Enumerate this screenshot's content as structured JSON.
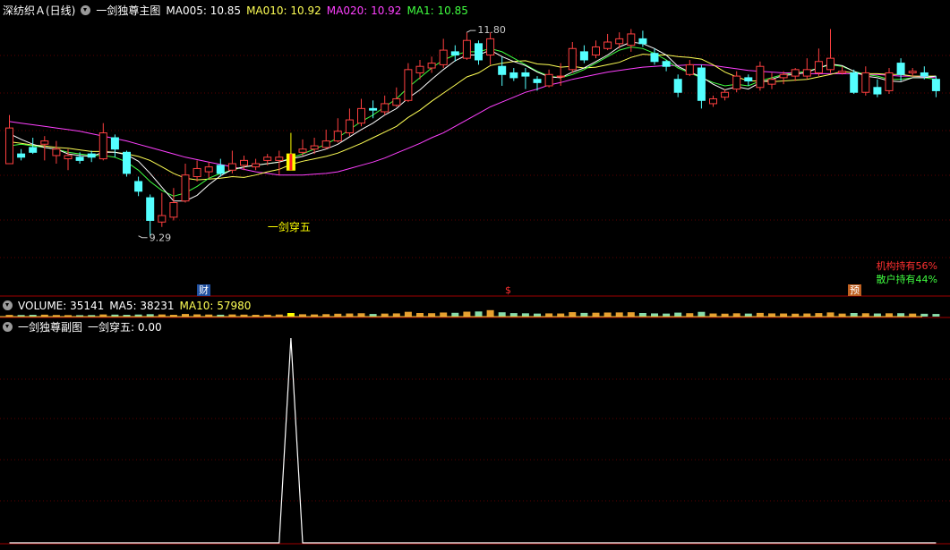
{
  "main_header": {
    "stock": "深纺织Ａ(日线)",
    "indicator": "一剑独尊主图",
    "ma005": "MA005: 10.85",
    "ma010": "MA010: 10.92",
    "ma020": "MA020: 10.92",
    "ma1": "MA1: 10.85"
  },
  "volume_header": {
    "volume": "VOLUME: 35141",
    "ma5": "MA5: 38231",
    "ma10": "MA10: 57980"
  },
  "sub_header": {
    "indicator": "一剑独尊副图",
    "value": "一剑穿五: 0.00"
  },
  "holdings": {
    "institution": "机构持有56%",
    "retail": "散户持有44%"
  },
  "badges": {
    "finance": "财",
    "dollar": "$",
    "forecast": "预"
  },
  "colors": {
    "up": "#ff4040",
    "down": "#54ffff",
    "ma5": "#ffffff",
    "ma10": "#ffff55",
    "ma20": "#ff40ff",
    "ma1": "#40ff40",
    "signal": "#ffff00",
    "background": "#000000",
    "grid": "#7a0000"
  },
  "chart_data": [
    {
      "type": "candlestick",
      "title": "一剑独尊主图",
      "annotations": [
        {
          "text": "11.80",
          "bar": 39,
          "value": 11.8,
          "kind": "high"
        },
        {
          "text": "9.29",
          "bar": 11,
          "value": 9.29,
          "kind": "low"
        },
        {
          "text": "一剑穿五",
          "bar": 24,
          "kind": "signal"
        }
      ],
      "signal_bar": 24,
      "ylim": [
        9.0,
        12.0
      ],
      "ohlc": [
        [
          10.18,
          10.62,
          10.78,
          10.32
        ],
        [
          10.3,
          10.26,
          10.36,
          10.22
        ],
        [
          10.38,
          10.32,
          10.5,
          10.3
        ],
        [
          10.42,
          10.46,
          10.52,
          10.22
        ],
        [
          10.28,
          10.36,
          10.46,
          10.18
        ],
        [
          10.24,
          10.28,
          10.36,
          10.1
        ],
        [
          10.26,
          10.22,
          10.32,
          10.18
        ],
        [
          10.3,
          10.26,
          10.34,
          10.2
        ],
        [
          10.24,
          10.56,
          10.68,
          10.22
        ],
        [
          10.5,
          10.36,
          10.54,
          10.26
        ],
        [
          10.32,
          10.06,
          10.34,
          10.02
        ],
        [
          9.96,
          9.84,
          10.02,
          9.78
        ],
        [
          9.76,
          9.48,
          9.8,
          9.29
        ],
        [
          9.46,
          9.54,
          9.82,
          9.4
        ],
        [
          9.52,
          9.7,
          9.88,
          9.48
        ],
        [
          9.72,
          10.04,
          10.18,
          9.7
        ],
        [
          10.02,
          10.12,
          10.22,
          9.96
        ],
        [
          10.08,
          10.14,
          10.2,
          10.0
        ],
        [
          10.16,
          10.06,
          10.24,
          10.02
        ],
        [
          10.1,
          10.18,
          10.34,
          10.06
        ],
        [
          10.16,
          10.22,
          10.28,
          10.1
        ],
        [
          10.14,
          10.18,
          10.24,
          10.1
        ],
        [
          10.22,
          10.26,
          10.3,
          10.16
        ],
        [
          10.22,
          10.26,
          10.34,
          10.04
        ],
        [
          10.1,
          10.3,
          10.56,
          10.1
        ],
        [
          10.32,
          10.36,
          10.48,
          10.28
        ],
        [
          10.36,
          10.4,
          10.5,
          10.3
        ],
        [
          10.38,
          10.46,
          10.6,
          10.36
        ],
        [
          10.46,
          10.58,
          10.74,
          10.44
        ],
        [
          10.56,
          10.72,
          10.86,
          10.52
        ],
        [
          10.68,
          10.86,
          10.98,
          10.64
        ],
        [
          10.86,
          10.84,
          10.96,
          10.74
        ],
        [
          10.82,
          10.92,
          11.02,
          10.78
        ],
        [
          10.9,
          10.98,
          11.12,
          10.88
        ],
        [
          10.96,
          11.34,
          11.42,
          10.94
        ],
        [
          11.3,
          11.38,
          11.46,
          11.22
        ],
        [
          11.36,
          11.42,
          11.5,
          11.3
        ],
        [
          11.4,
          11.58,
          11.72,
          11.36
        ],
        [
          11.56,
          11.52,
          11.64,
          11.44
        ],
        [
          11.48,
          11.7,
          11.8,
          11.46
        ],
        [
          11.66,
          11.46,
          11.7,
          11.4
        ],
        [
          11.52,
          11.72,
          11.8,
          11.4
        ],
        [
          11.38,
          11.28,
          11.5,
          11.14
        ],
        [
          11.3,
          11.24,
          11.36,
          11.2
        ],
        [
          11.3,
          11.26,
          11.36,
          11.1
        ],
        [
          11.22,
          11.18,
          11.26,
          11.08
        ],
        [
          11.14,
          11.28,
          11.34,
          11.12
        ],
        [
          11.26,
          11.26,
          11.42,
          11.14
        ],
        [
          11.34,
          11.6,
          11.68,
          11.3
        ],
        [
          11.56,
          11.46,
          11.64,
          11.42
        ],
        [
          11.52,
          11.62,
          11.7,
          11.48
        ],
        [
          11.6,
          11.68,
          11.78,
          11.58
        ],
        [
          11.66,
          11.72,
          11.8,
          11.6
        ],
        [
          11.64,
          11.78,
          11.84,
          11.56
        ],
        [
          11.72,
          11.66,
          11.82,
          11.62
        ],
        [
          11.54,
          11.44,
          11.6,
          11.4
        ],
        [
          11.44,
          11.38,
          11.46,
          11.32
        ],
        [
          11.22,
          11.06,
          11.28,
          11.0
        ],
        [
          11.28,
          11.4,
          11.46,
          11.26
        ],
        [
          11.36,
          10.96,
          11.4,
          10.86
        ],
        [
          10.92,
          10.98,
          11.02,
          10.88
        ],
        [
          11.0,
          11.06,
          11.1,
          10.96
        ],
        [
          11.1,
          11.26,
          11.32,
          11.06
        ],
        [
          11.24,
          11.2,
          11.28,
          11.14
        ],
        [
          11.12,
          11.38,
          11.44,
          11.08
        ],
        [
          11.16,
          11.22,
          11.3,
          11.1
        ],
        [
          11.24,
          11.28,
          11.32,
          11.16
        ],
        [
          11.26,
          11.34,
          11.36,
          11.2
        ],
        [
          11.26,
          11.34,
          11.48,
          11.22
        ],
        [
          11.3,
          11.44,
          11.6,
          11.26
        ],
        [
          11.34,
          11.48,
          11.84,
          11.3
        ],
        [
          11.3,
          11.32,
          11.38,
          11.28
        ],
        [
          11.3,
          11.06,
          11.34,
          11.04
        ],
        [
          11.06,
          11.3,
          11.38,
          11.02
        ],
        [
          11.12,
          11.04,
          11.22,
          11.0
        ],
        [
          11.08,
          11.3,
          11.36,
          11.04
        ],
        [
          11.42,
          11.28,
          11.48,
          11.2
        ],
        [
          11.3,
          11.32,
          11.36,
          11.26
        ],
        [
          11.3,
          11.26,
          11.38,
          11.22
        ],
        [
          11.22,
          11.08,
          11.26,
          11.0
        ]
      ],
      "ma5": [
        10.55,
        10.48,
        10.42,
        10.38,
        10.36,
        10.3,
        10.28,
        10.27,
        10.32,
        10.32,
        10.29,
        10.21,
        10.06,
        9.89,
        9.72,
        9.72,
        9.79,
        9.92,
        10.03,
        10.11,
        10.14,
        10.16,
        10.18,
        10.2,
        10.24,
        10.27,
        10.32,
        10.36,
        10.42,
        10.51,
        10.6,
        10.68,
        10.78,
        10.86,
        10.99,
        11.09,
        11.22,
        11.34,
        11.45,
        11.52,
        11.52,
        11.58,
        11.5,
        11.44,
        11.39,
        11.31,
        11.25,
        11.24,
        11.31,
        11.36,
        11.44,
        11.52,
        11.62,
        11.68,
        11.66,
        11.6,
        11.52,
        11.38,
        11.31,
        11.25,
        11.16,
        11.09,
        11.13,
        11.1,
        11.18,
        11.22,
        11.27,
        11.28,
        11.31,
        11.36,
        11.41,
        11.39,
        11.32,
        11.26,
        11.24,
        11.2,
        11.19,
        11.24,
        11.24,
        11.26
      ],
      "ma10": [
        10.45,
        10.43,
        10.41,
        10.4,
        10.38,
        10.37,
        10.35,
        10.33,
        10.33,
        10.32,
        10.3,
        10.27,
        10.22,
        10.14,
        10.06,
        10.0,
        9.98,
        9.99,
        10.0,
        10.02,
        10.01,
        10.04,
        10.08,
        10.11,
        10.17,
        10.21,
        10.24,
        10.27,
        10.31,
        10.37,
        10.43,
        10.5,
        10.57,
        10.64,
        10.75,
        10.84,
        10.95,
        11.05,
        11.15,
        11.25,
        11.3,
        11.39,
        11.42,
        11.44,
        11.45,
        11.41,
        11.4,
        11.37,
        11.38,
        11.36,
        11.37,
        11.4,
        11.43,
        11.49,
        11.53,
        11.52,
        11.52,
        11.5,
        11.49,
        11.47,
        11.4,
        11.31,
        11.25,
        11.2,
        11.2,
        11.19,
        11.2,
        11.21,
        11.22,
        11.25,
        11.28,
        11.32,
        11.3,
        11.29,
        11.29,
        11.28,
        11.28,
        11.26,
        11.26,
        11.26
      ],
      "ma20": [
        10.7,
        10.68,
        10.66,
        10.64,
        10.62,
        10.6,
        10.58,
        10.55,
        10.52,
        10.49,
        10.46,
        10.42,
        10.38,
        10.34,
        10.3,
        10.26,
        10.23,
        10.2,
        10.17,
        10.14,
        10.11,
        10.08,
        10.06,
        10.04,
        10.04,
        10.04,
        10.05,
        10.06,
        10.08,
        10.12,
        10.16,
        10.2,
        10.25,
        10.31,
        10.37,
        10.43,
        10.5,
        10.56,
        10.64,
        10.72,
        10.8,
        10.88,
        10.94,
        11.0,
        11.06,
        11.1,
        11.15,
        11.18,
        11.22,
        11.25,
        11.28,
        11.31,
        11.33,
        11.35,
        11.37,
        11.38,
        11.39,
        11.39,
        11.4,
        11.4,
        11.39,
        11.37,
        11.35,
        11.33,
        11.32,
        11.31,
        11.3,
        11.3,
        11.29,
        11.29,
        11.29,
        11.29,
        11.29,
        11.28,
        11.28,
        11.27,
        11.26,
        11.26,
        11.25,
        11.24
      ],
      "ma1": [
        10.4,
        10.42,
        10.4,
        10.38,
        10.36,
        10.32,
        10.3,
        10.28,
        10.28,
        10.26,
        10.2,
        10.1,
        9.96,
        9.85,
        9.78,
        9.82,
        9.9,
        10.0,
        10.06,
        10.1,
        10.14,
        10.16,
        10.18,
        10.2,
        10.25,
        10.3,
        10.36,
        10.42,
        10.5,
        10.6,
        10.7,
        10.78,
        10.88,
        10.98,
        11.12,
        11.24,
        11.36,
        11.46,
        11.52,
        11.56,
        11.56,
        11.6,
        11.56,
        11.48,
        11.4,
        11.32,
        11.26,
        11.24,
        11.28,
        11.34,
        11.42,
        11.5,
        11.58,
        11.62,
        11.6,
        11.54,
        11.46,
        11.36,
        11.3,
        11.24,
        11.18,
        11.14,
        11.16,
        11.14,
        11.2,
        11.24,
        11.28,
        11.3,
        11.32,
        11.36,
        11.4,
        11.38,
        11.32,
        11.28,
        11.26,
        11.22,
        11.22,
        11.24,
        11.24,
        11.22
      ]
    },
    {
      "type": "bar",
      "title": "VOLUME",
      "values": [
        20,
        18,
        22,
        25,
        18,
        16,
        15,
        17,
        30,
        26,
        22,
        28,
        35,
        30,
        22,
        40,
        32,
        28,
        24,
        30,
        26,
        22,
        24,
        28,
        60,
        34,
        30,
        36,
        45,
        50,
        55,
        40,
        48,
        52,
        85,
        60,
        56,
        70,
        64,
        88,
        92,
        120,
        75,
        58,
        54,
        48,
        52,
        50,
        78,
        62,
        66,
        70,
        72,
        76,
        60,
        52,
        48,
        68,
        56,
        84,
        50,
        46,
        54,
        48,
        62,
        52,
        50,
        46,
        50,
        58,
        72,
        48,
        60,
        55,
        50,
        54,
        56,
        48,
        44,
        40
      ],
      "ylim": [
        0,
        150
      ]
    },
    {
      "type": "line",
      "title": "一剑独尊副图",
      "x": "bar index",
      "values": [
        0,
        0,
        0,
        0,
        0,
        0,
        0,
        0,
        0,
        0,
        0,
        0,
        0,
        0,
        0,
        0,
        0,
        0,
        0,
        0,
        0,
        0,
        0,
        0,
        1,
        0,
        0,
        0,
        0,
        0,
        0,
        0,
        0,
        0,
        0,
        0,
        0,
        0,
        0,
        0,
        0,
        0,
        0,
        0,
        0,
        0,
        0,
        0,
        0,
        0,
        0,
        0,
        0,
        0,
        0,
        0,
        0,
        0,
        0,
        0,
        0,
        0,
        0,
        0,
        0,
        0,
        0,
        0,
        0,
        0,
        0,
        0,
        0,
        0,
        0,
        0,
        0,
        0,
        0,
        0
      ],
      "ylim": [
        0,
        1
      ]
    }
  ]
}
